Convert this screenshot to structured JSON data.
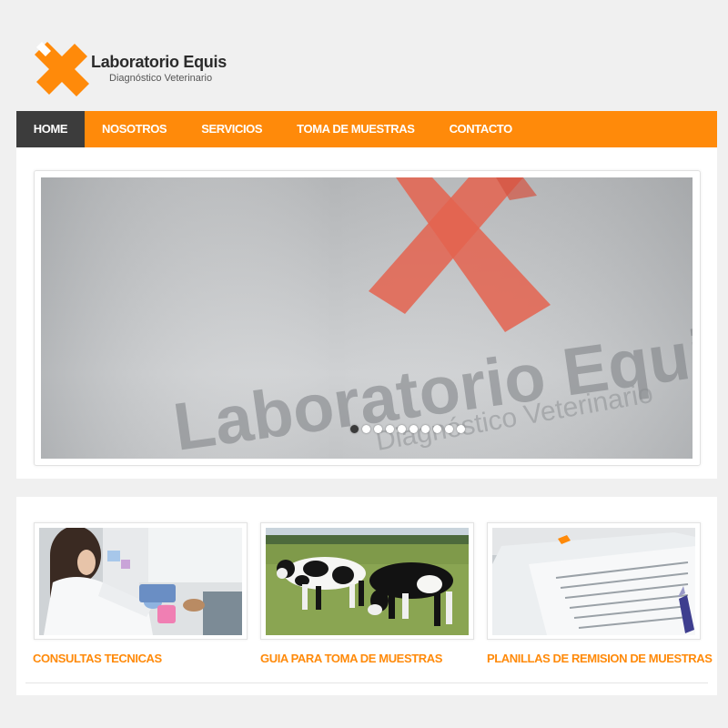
{
  "brand": {
    "name": "Laboratorio Equis",
    "tagline": "Diagnóstico Veterinario",
    "accent": "#ff8a0a",
    "dark": "#3c3c3c"
  },
  "nav": {
    "items": [
      {
        "label": "HOME",
        "active": true
      },
      {
        "label": "NOSOTROS",
        "active": false
      },
      {
        "label": "SERVICIOS",
        "active": false
      },
      {
        "label": "TOMA DE MUESTRAS",
        "active": false
      },
      {
        "label": "CONTACTO",
        "active": false
      }
    ]
  },
  "slider": {
    "slide_text": "Laboratorio Equis",
    "slide_sub": "Diagnóstico Veterinario",
    "dots": 10,
    "active_dot": 1
  },
  "features": [
    {
      "title": "CONSULTAS TECNICAS",
      "image": "lab-technician-photo"
    },
    {
      "title": "GUIA PARA TOMA DE MUESTRAS",
      "image": "cows-in-field-photo"
    },
    {
      "title": "PLANILLAS DE REMISION DE MUESTRAS",
      "image": "forms-and-pen-photo"
    }
  ]
}
